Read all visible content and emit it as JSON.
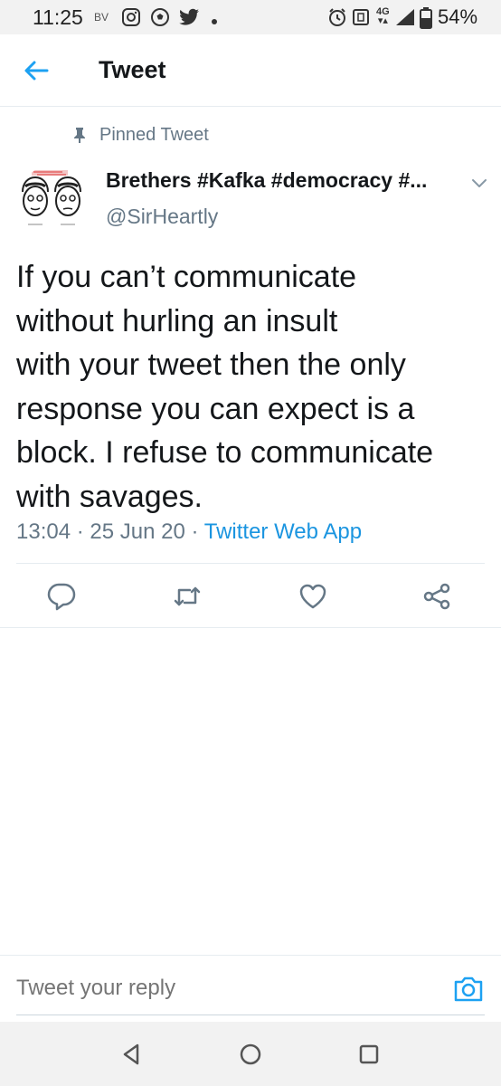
{
  "status_bar": {
    "time": "11:25",
    "carrier": "BV",
    "network": "4G",
    "battery_percent": "54%",
    "icons": [
      "instagram-icon",
      "soccer-ball-icon",
      "twitter-icon",
      "dot-icon",
      "alarm-icon",
      "vibrate-icon",
      "signal-icon",
      "battery-icon"
    ]
  },
  "header": {
    "title": "Tweet",
    "back_icon": "arrow-left-icon"
  },
  "tweet": {
    "pinned_label": "Pinned Tweet",
    "author_name": "Brethers #Kafka #democracy #...",
    "author_handle": "@SirHeartly",
    "text_lines": [
      "If you can’t communicate",
      "without hurling an insult",
      "with your tweet then the only",
      "response you can expect is a",
      "block. I refuse to communicate",
      "with savages."
    ],
    "time": "13:04",
    "date": "25 Jun 20",
    "separator": "·",
    "source": "Twitter Web App",
    "actions": [
      "reply-icon",
      "retweet-icon",
      "like-icon",
      "share-icon"
    ]
  },
  "reply": {
    "placeholder": "Tweet your reply",
    "camera_icon": "camera-icon"
  },
  "nav": {
    "buttons": [
      "back-triangle-icon",
      "home-circle-icon",
      "recents-square-icon"
    ]
  },
  "colors": {
    "accent": "#1da1f2",
    "link": "#1b95e0",
    "secondary_text": "#657786",
    "primary_text": "#14171a",
    "divider": "#e6ecf0"
  }
}
